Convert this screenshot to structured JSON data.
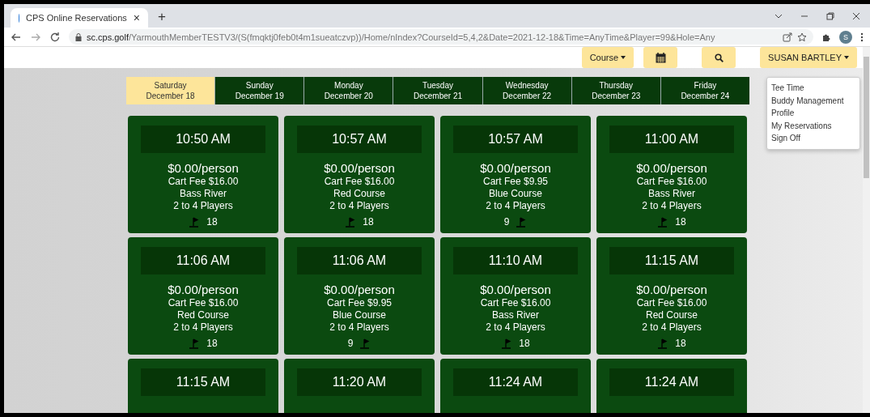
{
  "browser": {
    "tab_title": "CPS Online Reservations",
    "tab_close": "×",
    "new_tab": "+",
    "url_host": "sc.cps.golf",
    "url_path": "/YarmouthMemberTESTV3/(S(fmqktj0feb0t4m1sueatczvp))/Home/nIndex?CourseId=5,4,2&Date=2021-12-18&Time=AnyTime&Player=99&Hole=Any",
    "profile_initial": "S"
  },
  "toolbar": {
    "course_button": "Course",
    "user_button": "SUSAN BARTLEY"
  },
  "user_menu": {
    "expanded": true,
    "items": [
      "Tee Time",
      "Buddy Management",
      "Profile",
      "My Reservations",
      "Sign Off"
    ]
  },
  "days": [
    {
      "weekday": "Saturday",
      "date": "December 18",
      "selected": true
    },
    {
      "weekday": "Sunday",
      "date": "December 19",
      "selected": false
    },
    {
      "weekday": "Monday",
      "date": "December 20",
      "selected": false
    },
    {
      "weekday": "Tuesday",
      "date": "December 21",
      "selected": false
    },
    {
      "weekday": "Wednesday",
      "date": "December 22",
      "selected": false
    },
    {
      "weekday": "Thursday",
      "date": "December 23",
      "selected": false
    },
    {
      "weekday": "Friday",
      "date": "December 24",
      "selected": false
    }
  ],
  "tee_times": [
    {
      "time": "10:50 AM",
      "price": "$0.00/person",
      "cart_fee": "Cart Fee $16.00",
      "course": "Bass River",
      "players": "2 to 4 Players",
      "holes": "18",
      "kind": "flag-first"
    },
    {
      "time": "10:57 AM",
      "price": "$0.00/person",
      "cart_fee": "Cart Fee $16.00",
      "course": "Red Course",
      "players": "2 to 4 Players",
      "holes": "18",
      "kind": "flag-first"
    },
    {
      "time": "10:57 AM",
      "price": "$0.00/person",
      "cart_fee": "Cart Fee $9.95",
      "course": "Blue Course",
      "players": "2 to 4 Players",
      "holes": "9",
      "kind": "number-first"
    },
    {
      "time": "11:00 AM",
      "price": "$0.00/person",
      "cart_fee": "Cart Fee $16.00",
      "course": "Bass River",
      "players": "2 to 4 Players",
      "holes": "18",
      "kind": "flag-first"
    },
    {
      "time": "11:06 AM",
      "price": "$0.00/person",
      "cart_fee": "Cart Fee $16.00",
      "course": "Red Course",
      "players": "2 to 4 Players",
      "holes": "18",
      "kind": "flag-first"
    },
    {
      "time": "11:06 AM",
      "price": "$0.00/person",
      "cart_fee": "Cart Fee $9.95",
      "course": "Blue Course",
      "players": "2 to 4 Players",
      "holes": "9",
      "kind": "number-first"
    },
    {
      "time": "11:10 AM",
      "price": "$0.00/person",
      "cart_fee": "Cart Fee $16.00",
      "course": "Bass River",
      "players": "2 to 4 Players",
      "holes": "18",
      "kind": "flag-first"
    },
    {
      "time": "11:15 AM",
      "price": "$0.00/person",
      "cart_fee": "Cart Fee $16.00",
      "course": "Red Course",
      "players": "2 to 4 Players",
      "holes": "18",
      "kind": "flag-first"
    },
    {
      "time": "11:15 AM"
    },
    {
      "time": "11:20 AM"
    },
    {
      "time": "11:24 AM"
    },
    {
      "time": "11:24 AM"
    }
  ]
}
